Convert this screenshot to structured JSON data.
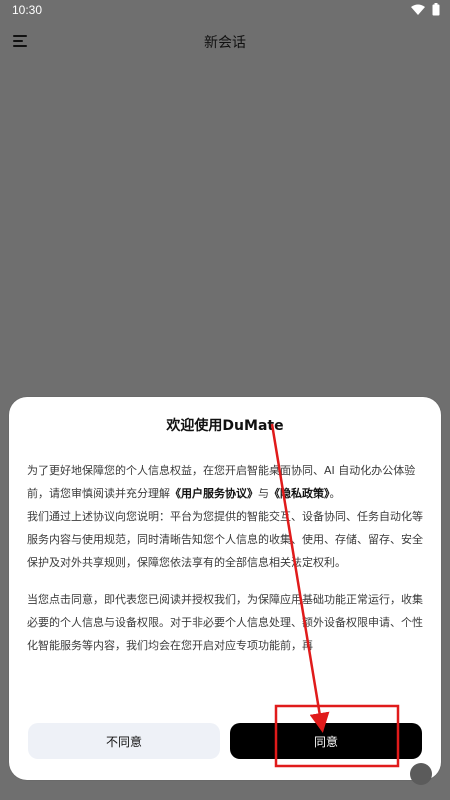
{
  "status_bar": {
    "time": "10:30",
    "wifi_icon": "wifi-icon",
    "battery_icon": "battery-icon"
  },
  "topbar": {
    "menu_icon": "menu-icon",
    "title": "新会话"
  },
  "dialog": {
    "title": "欢迎使用DuMate",
    "p1": {
      "before": "为了更好地保障您的个人信息权益，在您开启智能桌面协同、AI 自动化办公体验前，请您审慎阅读并充分理解",
      "link1": "《用户服务协议》",
      "middle": "与",
      "link2": "《隐私政策》",
      "after": "。"
    },
    "p2": "我们通过上述协议向您说明：平台为您提供的智能交互、设备协同、任务自动化等服务内容与使用规范，同时清晰告知您个人信息的收集、使用、存储、留存、安全保护及对外共享规则，保障您依法享有的全部信息相关法定权利。",
    "p3": "当您点击同意，即代表您已阅读并授权我们，为保障应用基础功能正常运行，收集必要的个人信息与设备权限。对于非必要个人信息处理、额外设备权限申请、个性化智能服务等内容，我们均会在您开启对应专项功能前，再",
    "buttons": {
      "disagree": "不同意",
      "agree": "同意"
    }
  },
  "annotation": {
    "color": "#e01b1b"
  }
}
